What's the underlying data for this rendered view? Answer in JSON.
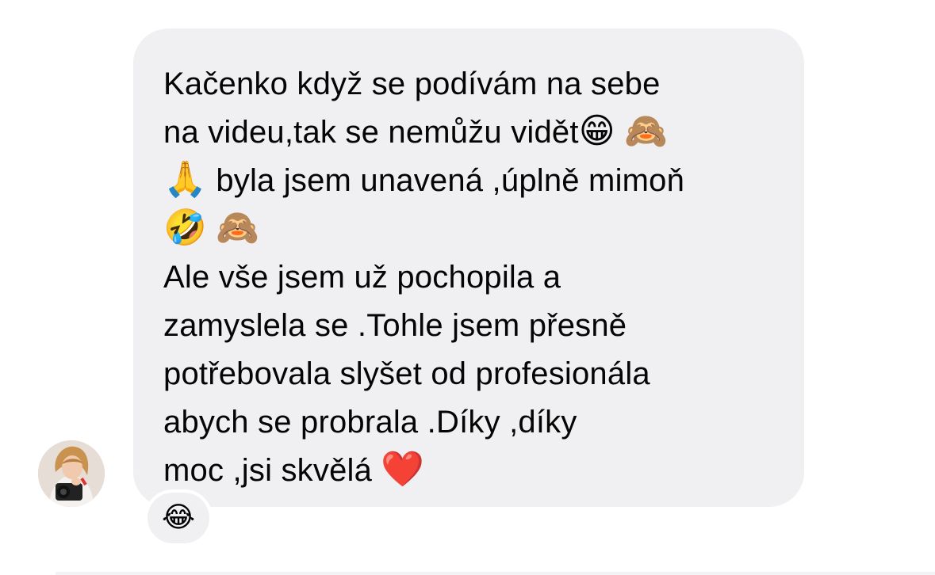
{
  "message": {
    "lines": [
      {
        "text": "Kačenko když se podívám na sebe",
        "emojis": []
      },
      {
        "text": "na videu,tak se nemůžu vidět",
        "emojis": [
          "😁",
          "🙈"
        ]
      },
      {
        "text": " byla jsem unavená ,úplně mimoň",
        "lead_emoji": "🙏",
        "emojis": []
      },
      {
        "text": "",
        "emojis": [
          "🤣",
          "🙈"
        ]
      },
      {
        "text": "Ale vše jsem už pochopila a",
        "emojis": []
      },
      {
        "text": "zamyslela se .Tohle jsem přesně",
        "emojis": []
      },
      {
        "text": "potřebovala slyšet od profesionála",
        "emojis": []
      },
      {
        "text": "abych se probrala .Díky ,díky",
        "emojis": []
      },
      {
        "text": "moc ,jsi skvělá ",
        "emojis": [
          "❤️"
        ]
      }
    ]
  },
  "reaction": {
    "emoji": "😂"
  },
  "avatar": {
    "icon": "profile-photo-avatar"
  },
  "colors": {
    "bubble": "#f0f0f2",
    "text": "#050505",
    "background": "#ffffff"
  }
}
